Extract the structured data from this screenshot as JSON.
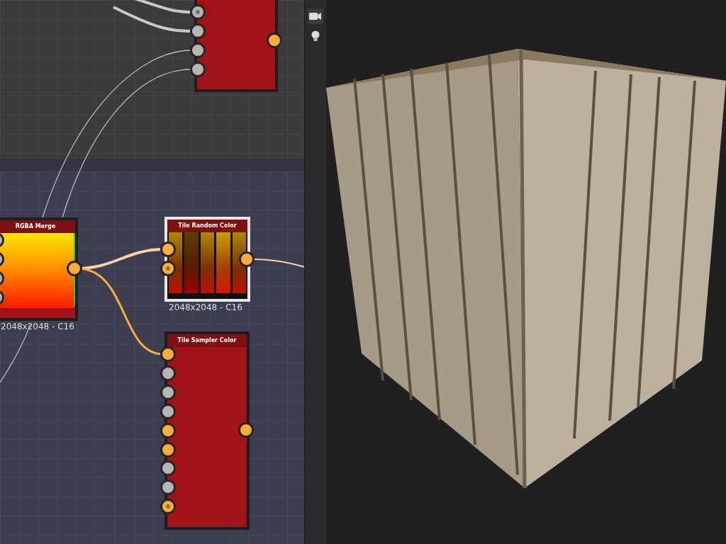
{
  "graph": {
    "nodes": [
      {
        "selected": false,
        "kind": "plain",
        "inputs": [
          {
            "kind": "gray",
            "dot": true
          },
          {
            "kind": "gray",
            "dot": false
          },
          {
            "kind": "gray",
            "dot": false
          },
          {
            "kind": "gray",
            "dot": false
          }
        ],
        "output": {
          "kind": "color"
        }
      },
      {
        "title": "RGBA Merge",
        "resolution": "2048x2048 - C16",
        "selected": false,
        "kind": "gradient",
        "inputs": [
          {
            "kind": "gray"
          },
          {
            "kind": "gray"
          },
          {
            "kind": "gray"
          },
          {
            "kind": "gray"
          }
        ],
        "output": {
          "kind": "color"
        }
      },
      {
        "title": "Tile Random Color",
        "resolution": "2048x2048 - C16",
        "selected": true,
        "kind": "stripes",
        "inputs": [
          {
            "kind": "color",
            "dot": false
          },
          {
            "kind": "color",
            "dot": true
          }
        ],
        "output": {
          "kind": "color"
        }
      },
      {
        "title": "Tile Sampler Color",
        "selected": false,
        "kind": "plain",
        "inputs": [
          {
            "kind": "color",
            "dot": false
          },
          {
            "kind": "gray",
            "dot": false
          },
          {
            "kind": "gray",
            "dot": false
          },
          {
            "kind": "gray",
            "dot": false
          },
          {
            "kind": "color",
            "dot": false
          },
          {
            "kind": "color",
            "dot": false
          },
          {
            "kind": "gray",
            "dot": false
          },
          {
            "kind": "gray",
            "dot": false
          },
          {
            "kind": "color",
            "dot": true
          }
        ],
        "output": {
          "kind": "color"
        }
      }
    ]
  }
}
